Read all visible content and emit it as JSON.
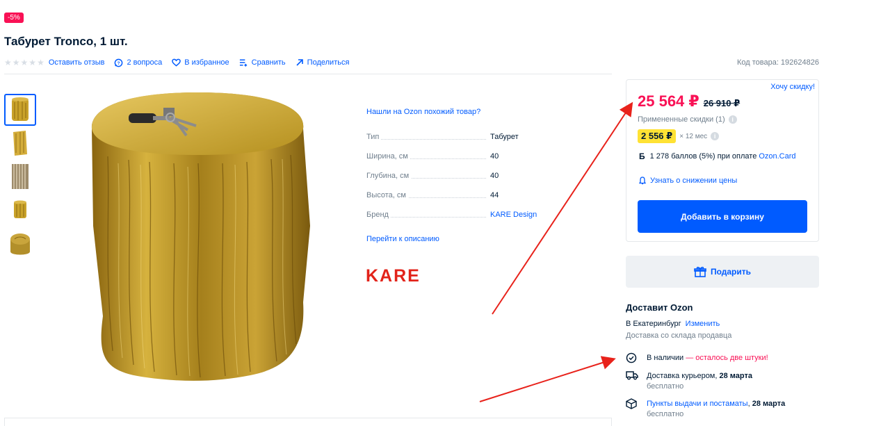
{
  "breadcrumb": {
    "cut_text": "...",
    "link_text": ""
  },
  "discount_badge": "-5%",
  "product": {
    "title": "Табурет Tronco, 1 шт.",
    "rating_stars": 5,
    "sku_label": "Код товара: 192624826"
  },
  "actions": {
    "review": "Оставить отзыв",
    "questions": "2 вопроса",
    "favorite": "В избранное",
    "compare": "Сравнить",
    "share": "Поделиться"
  },
  "thumbnails": [
    {
      "name": "thumb-stump-front",
      "active": true
    },
    {
      "name": "thumb-stump-side",
      "active": false
    },
    {
      "name": "thumb-stump-texture",
      "active": false
    },
    {
      "name": "thumb-stump-small",
      "active": false
    },
    {
      "name": "thumb-stump-top",
      "active": false
    }
  ],
  "specs": {
    "similar_link": "Нашли на Ozon похожий товар?",
    "rows": [
      {
        "key": "Тип",
        "value": "Табурет",
        "link": false
      },
      {
        "key": "Ширина, см",
        "value": "40",
        "link": false
      },
      {
        "key": "Глубина, см",
        "value": "40",
        "link": false
      },
      {
        "key": "Высота, см",
        "value": "44",
        "link": false
      },
      {
        "key": "Бренд",
        "value": "KARE Design",
        "link": true
      }
    ],
    "go_to_description": "Перейти к описанию",
    "brand_logo_text": "KARE"
  },
  "price_box": {
    "want_discount": "Хочу скидку!",
    "price": "25 564 ₽",
    "old_price": "26 910 ₽",
    "applied_discounts": "Примененные скидки (1)",
    "installment_price": "2 556 ₽",
    "installment_months": "× 12 мес",
    "bonus_icon": "Б",
    "bonus_text": "1 278 баллов (5%) при оплате",
    "bonus_link": "Ozon.Card",
    "notify_price": "Узнать о снижении цены",
    "add_to_cart": "Добавить в корзину"
  },
  "gift_button": "Подарить",
  "delivery": {
    "title": "Доставит Ozon",
    "city_prefix": "В Екатеринбург",
    "change_link": "Изменить",
    "from_seller": "Доставка со склада продавца",
    "in_stock": "В наличии",
    "in_stock_warning": "— осталось две штуки!",
    "courier": "Доставка курьером, ",
    "courier_date": "28 марта",
    "courier_cost": "бесплатно",
    "pickup": "Пункты выдачи и постаматы",
    "pickup_date": "28 марта",
    "pickup_cost": "бесплатно"
  },
  "colors": {
    "accent_blue": "#005bff",
    "price_red": "#f91155",
    "installment_yellow": "#ffe234",
    "annotation_arrow": "#e8221b"
  }
}
